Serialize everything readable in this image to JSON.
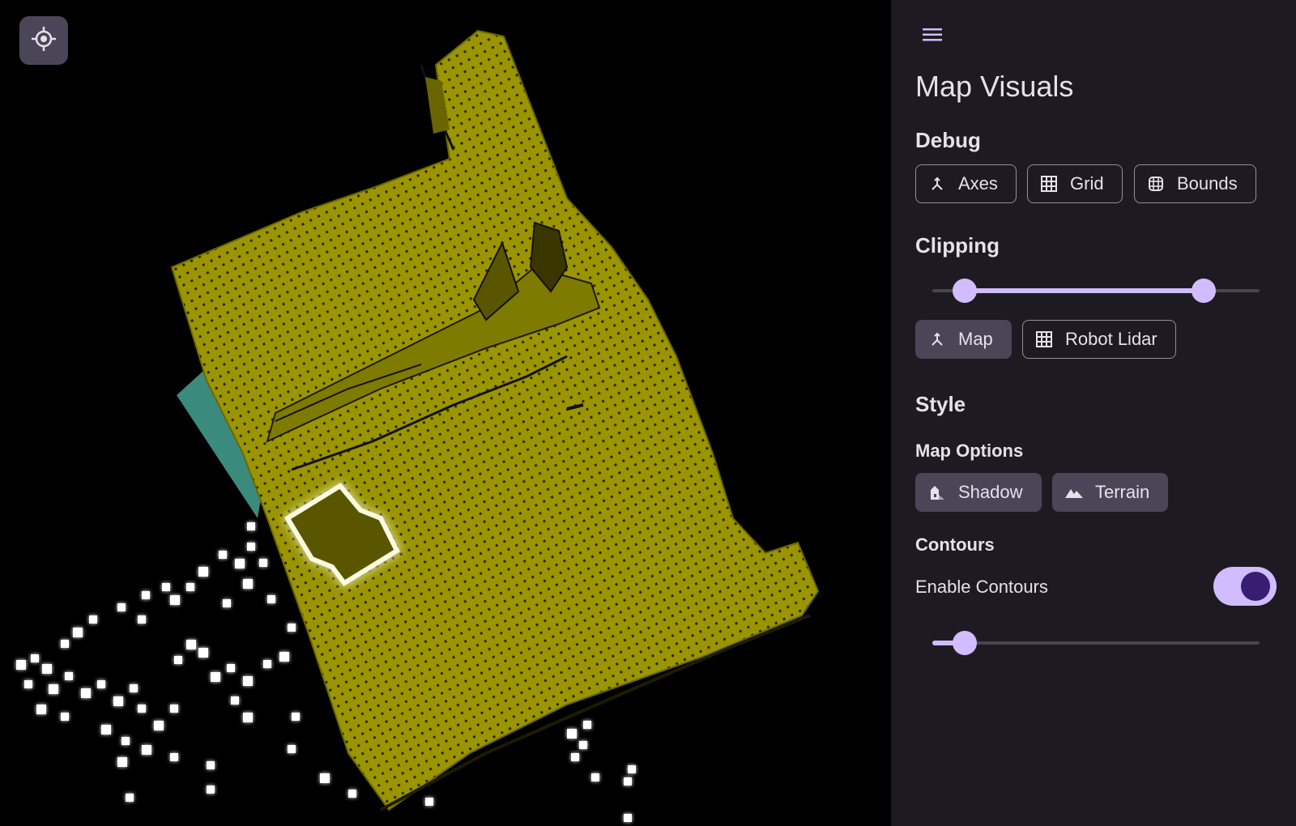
{
  "panel": {
    "title": "Map Visuals",
    "debug": {
      "label": "Debug",
      "chips": [
        {
          "label": "Axes",
          "icon": "axes-icon",
          "selected": false
        },
        {
          "label": "Grid",
          "icon": "grid-icon",
          "selected": false
        },
        {
          "label": "Bounds",
          "icon": "bounds-icon",
          "selected": false
        }
      ]
    },
    "clipping": {
      "label": "Clipping",
      "range_low": 0.1,
      "range_high": 0.83,
      "chips": [
        {
          "label": "Map",
          "icon": "axes-icon",
          "selected": true
        },
        {
          "label": "Robot Lidar",
          "icon": "grid-icon",
          "selected": false
        }
      ]
    },
    "style": {
      "label": "Style",
      "map_options": {
        "label": "Map Options",
        "chips": [
          {
            "label": "Shadow",
            "icon": "shadow-icon",
            "selected": true
          },
          {
            "label": "Terrain",
            "icon": "terrain-icon",
            "selected": true
          }
        ]
      },
      "contours": {
        "label": "Contours",
        "toggle_label": "Enable Contours",
        "enabled": true,
        "level": 0.1
      }
    }
  },
  "colors": {
    "accent": "#d0bcff",
    "panel_bg": "#1d1b21",
    "map_voxels": "#9a9500",
    "lidar_points": "#ffffff",
    "floor_plane": "#3b8a7e"
  }
}
